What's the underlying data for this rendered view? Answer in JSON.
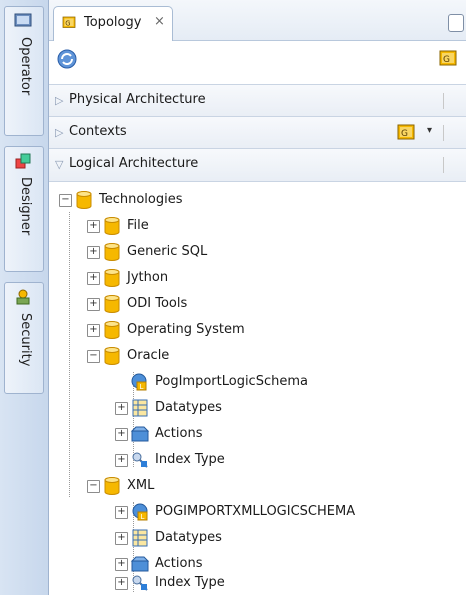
{
  "left_tabs": [
    {
      "label": "Operator"
    },
    {
      "label": "Designer"
    },
    {
      "label": "Security"
    }
  ],
  "tab": {
    "title": "Topology",
    "close": "×"
  },
  "accordion": [
    {
      "label": "Physical Architecture",
      "state": "collapsed"
    },
    {
      "label": "Contexts",
      "state": "collapsed"
    },
    {
      "label": "Logical Architecture",
      "state": "expanded"
    }
  ],
  "tree": {
    "root": "Technologies",
    "file": "File",
    "generic_sql": "Generic SQL",
    "jython": "Jython",
    "odi_tools": "ODI Tools",
    "operating_system": "Operating System",
    "oracle": "Oracle",
    "oracle_schema": "PogImportLogicSchema",
    "oracle_datatypes": "Datatypes",
    "oracle_actions": "Actions",
    "oracle_index_type": "Index Type",
    "xml": "XML",
    "xml_schema": "POGIMPORTXMLLOGICSCHEMA",
    "xml_datatypes": "Datatypes",
    "xml_actions": "Actions",
    "xml_index_type": "Index Type"
  },
  "colors": {
    "folder": "#f6b800",
    "panel_border": "#9fb3cf",
    "accent": "#2e6fc2"
  }
}
